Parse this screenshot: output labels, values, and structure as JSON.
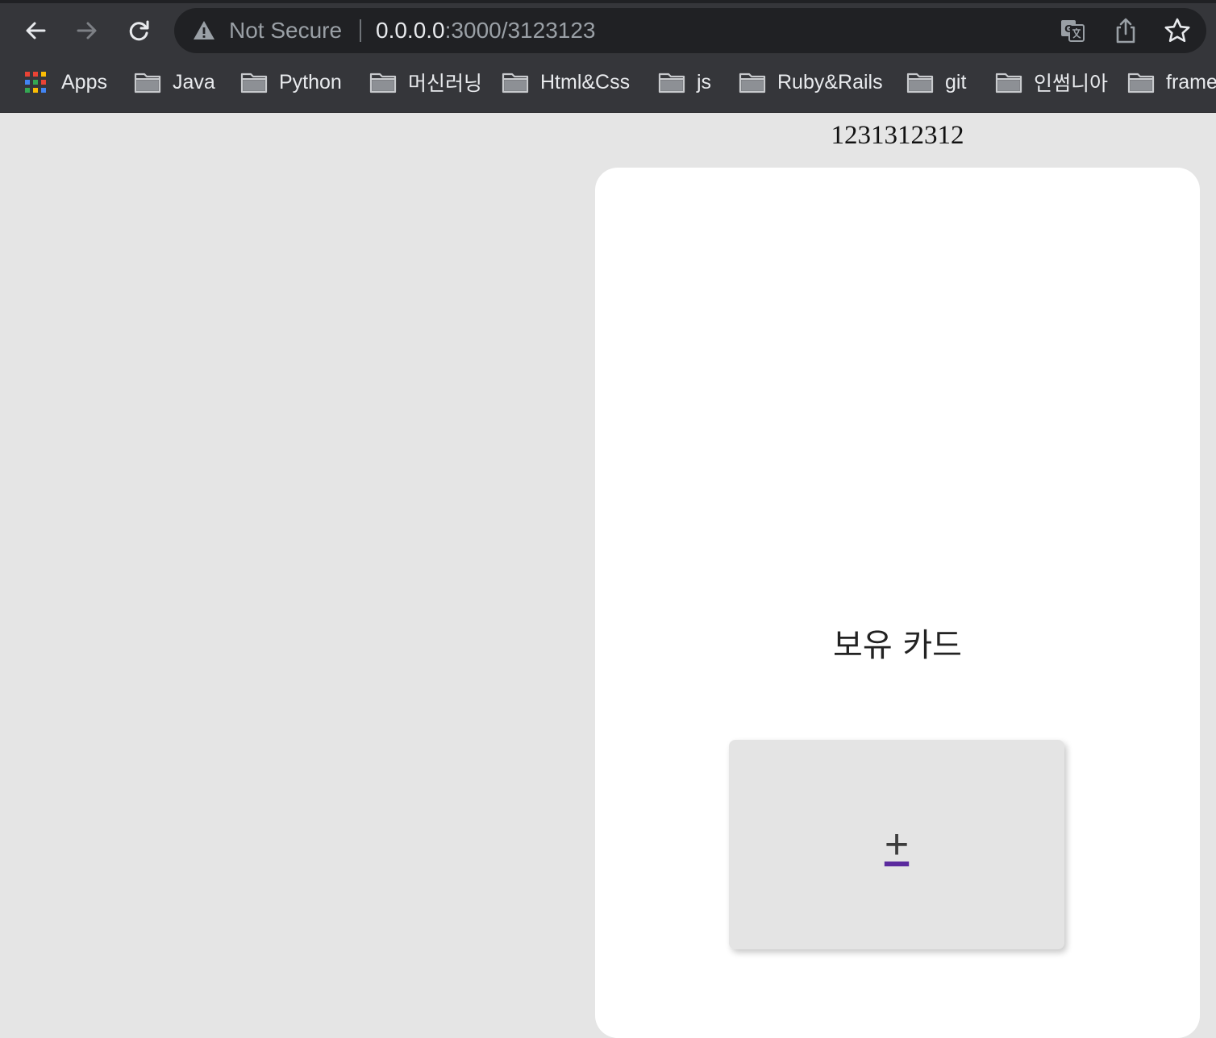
{
  "browser": {
    "security_label": "Not Secure",
    "url_host": "0.0.0.0",
    "url_rest": ":3000/3123123",
    "nav": [
      "back-icon",
      "forward-icon",
      "reload-icon"
    ],
    "actions": [
      "translate-icon",
      "share-icon",
      "star-icon"
    ]
  },
  "bookmarks": [
    {
      "label": "Apps",
      "icon": "apps-grid-icon"
    },
    {
      "label": "Java",
      "icon": "folder-icon"
    },
    {
      "label": "Python",
      "icon": "folder-icon"
    },
    {
      "label": "머신러닝",
      "icon": "folder-icon"
    },
    {
      "label": "Html&Css",
      "icon": "folder-icon"
    },
    {
      "label": "js",
      "icon": "folder-icon"
    },
    {
      "label": "Ruby&Rails",
      "icon": "folder-icon"
    },
    {
      "label": "git",
      "icon": "folder-icon"
    },
    {
      "label": "인썸니아",
      "icon": "folder-icon"
    },
    {
      "label": "frame",
      "icon": "folder-icon"
    }
  ],
  "page": {
    "heading": "1231312312",
    "panel_title": "보유 카드",
    "add_card_symbol": "+"
  },
  "colors": {
    "chrome_bg": "#35363a",
    "omnibox_bg": "#202124",
    "page_bg": "#e5e5e5",
    "panel_bg": "#ffffff",
    "add_underline": "#5b2a9e"
  }
}
